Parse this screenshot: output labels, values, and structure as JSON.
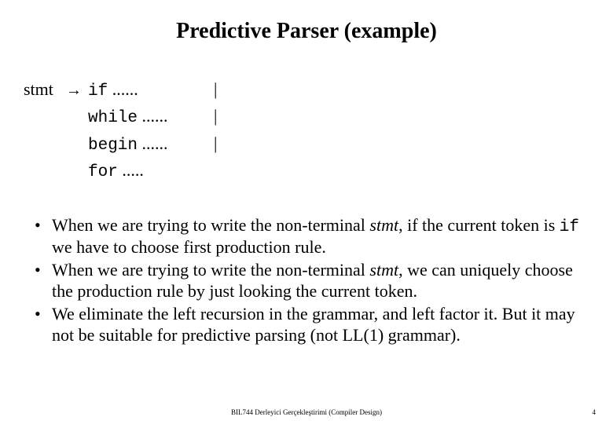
{
  "title": "Predictive Parser (example)",
  "grammar": {
    "lhs": "stmt",
    "arrow": "→",
    "rows": [
      {
        "kw": "if",
        "dots": " ......",
        "bar": "|"
      },
      {
        "kw": "while",
        "dots": " ......",
        "bar": "|"
      },
      {
        "kw": "begin",
        "dots": " ......",
        "bar": "|"
      },
      {
        "kw": "for",
        "dots": " .....",
        "bar": ""
      }
    ]
  },
  "bullets": {
    "b1a": "When we are trying to write the non-terminal ",
    "b1_stmt": "stmt",
    "b1b": ", if the current token is ",
    "b1_if": "if",
    "b1c": " we have to choose first production rule.",
    "b2a": "When we are trying to write the non-terminal ",
    "b2_stmt": "stmt",
    "b2b": ", we can uniquely choose the production rule by just looking the current token.",
    "b3": "We eliminate the left recursion in the grammar, and left factor it. But it may not be suitable for predictive parsing (not LL(1) grammar)."
  },
  "footer": "BIL744 Derleyici Gerçekleştirimi (Compiler Design)",
  "pagenum": "4"
}
